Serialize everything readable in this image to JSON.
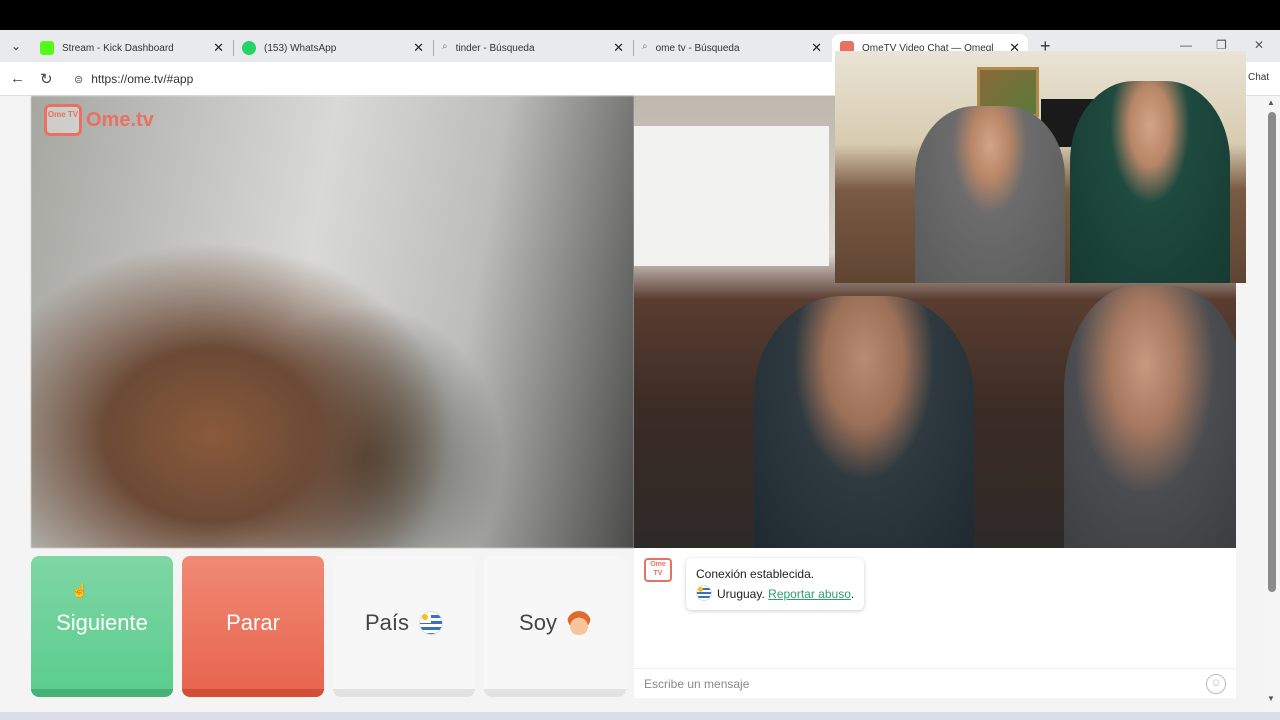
{
  "browser": {
    "tabs": [
      {
        "label": "Stream - Kick Dashboard",
        "favicon_color": "#53fc18"
      },
      {
        "label": "(153) WhatsApp",
        "favicon_color": "#25d366"
      },
      {
        "label": "tinder - Búsqueda",
        "favicon_color": "#888888"
      },
      {
        "label": "ome tv - Búsqueda",
        "favicon_color": "#888888"
      },
      {
        "label": "OmeTV Video Chat — Omegl",
        "favicon_color": "#e97064"
      }
    ],
    "url": "https://ome.tv/#app",
    "chat_extension_label": "Chat"
  },
  "app": {
    "logo_text": "Ome.tv",
    "logo_badge": "Ome TV",
    "buttons": {
      "next": "Siguiente",
      "stop": "Parar",
      "country": "País",
      "soy": "Soy"
    },
    "chat": {
      "logo_badge": "Ome TV",
      "message_connected": "Conexión establecida.",
      "country": "Uruguay.",
      "report_link": "Reportar abuso",
      "input_placeholder": "Escribe un mensaje"
    }
  },
  "colors": {
    "next": "#5ccd8e",
    "stop": "#e8654e",
    "brand": "#e97064"
  }
}
